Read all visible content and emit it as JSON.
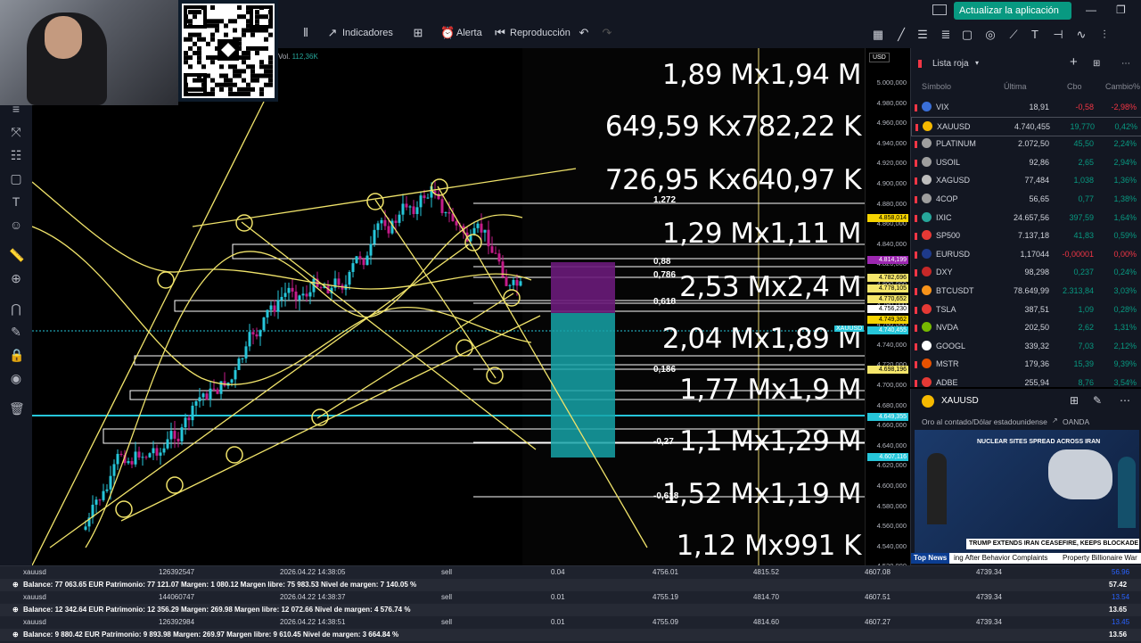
{
  "window": {
    "update_button": "Actualizar la aplicación",
    "minimize": "—",
    "maximize": "❐"
  },
  "toolbar": {
    "indicators": "Indicadores",
    "alert": "Alerta",
    "replay": "Reproducción"
  },
  "chart": {
    "volume_label": "Vol.",
    "volume_value": "112,36K",
    "currency": "USD",
    "symbol_tag": "XAUUSD",
    "price_labels": [
      "5.000,000",
      "4.980,000",
      "4.960,000",
      "4.940,000",
      "4.920,000",
      "4.900,000",
      "4.880,000",
      "4.860,000",
      "4.840,000",
      "4.820,000",
      "4.800,000",
      "4.780,000",
      "4.760,000",
      "4.740,000",
      "4.720,000",
      "4.700,000",
      "4.680,000",
      "4.660,000",
      "4.640,000",
      "4.620,000",
      "4.600,000",
      "4.580,000",
      "4.560,000",
      "4.540,000",
      "4.520,000",
      "4.500,000"
    ],
    "price_tags": [
      {
        "text": "4.858,014",
        "color": "#f5d300"
      },
      {
        "text": "4.814,199",
        "color": "#9c27b0"
      },
      {
        "text": "4.782,696",
        "color": "#f5e66b"
      },
      {
        "text": "4.778,105",
        "color": "#f5e66b"
      },
      {
        "text": "4.770,652",
        "color": "#f5e66b"
      },
      {
        "text": "4.756,230",
        "color": "#ffffff"
      },
      {
        "text": "4.749,362",
        "color": "#f5d300"
      },
      {
        "text": "4.740,455",
        "color": "#26c6da"
      },
      {
        "text": "4.698,196",
        "color": "#f5e66b"
      },
      {
        "text": "4.649,355",
        "color": "#26c6da"
      },
      {
        "text": "4.607,116",
        "color": "#26c6da"
      }
    ],
    "overlay_texts": [
      "1,89 Mx1,94 M",
      "649,59 Kx782,22 K",
      "726,95 Kx640,97 K",
      "1,29 Mx1,11 M",
      "2,53 Mx2,4 M",
      "2,04 Mx1,89 M",
      "1,77 Mx1,9 M",
      "1,1 Mx1,29 M",
      "1,52 Mx1,19 M",
      "1,12 Mx991 K"
    ],
    "fib_levels": [
      "1,272",
      "0,88",
      "0,786",
      "0,618",
      "0,186",
      "-0,27",
      "-0,618"
    ]
  },
  "watchlist": {
    "title": "Lista roja",
    "columns": {
      "symbol": "Símbolo",
      "last": "Última",
      "chg": "Cbo",
      "pct": "Cambio%"
    },
    "rows": [
      {
        "sym": "VIX",
        "last": "18,91",
        "chg": "-0,58",
        "pct": "-2,98%",
        "dir": "neg",
        "logo": "#3a6fd8"
      },
      {
        "sym": "XAUUSD",
        "last": "4.740,455",
        "chg": "19,770",
        "pct": "0,42%",
        "dir": "pos",
        "logo": "#f5b900"
      },
      {
        "sym": "PLATINUM",
        "last": "2.072,50",
        "chg": "45,50",
        "pct": "2,24%",
        "dir": "pos",
        "logo": "#9e9e9e"
      },
      {
        "sym": "USOIL",
        "last": "92,86",
        "chg": "2,65",
        "pct": "2,94%",
        "dir": "pos",
        "logo": "#9e9e9e"
      },
      {
        "sym": "XAGUSD",
        "last": "77,484",
        "chg": "1,038",
        "pct": "1,36%",
        "dir": "pos",
        "logo": "#bdbdbd"
      },
      {
        "sym": "4COP",
        "last": "56,65",
        "chg": "0,77",
        "pct": "1,38%",
        "dir": "pos",
        "logo": "#9e9e9e"
      },
      {
        "sym": "IXIC",
        "last": "24.657,56",
        "chg": "397,59",
        "pct": "1,64%",
        "dir": "pos",
        "logo": "#26a69a"
      },
      {
        "sym": "SP500",
        "last": "7.137,18",
        "chg": "41,83",
        "pct": "0,59%",
        "dir": "pos",
        "logo": "#e53935"
      },
      {
        "sym": "EURUSD",
        "last": "1,17044",
        "chg": "-0,00001",
        "pct": "0,00%",
        "dir": "neg",
        "logo": "#1e3a8a"
      },
      {
        "sym": "DXY",
        "last": "98,298",
        "chg": "0,237",
        "pct": "0,24%",
        "dir": "pos",
        "logo": "#c62828"
      },
      {
        "sym": "BTCUSDT",
        "last": "78.649,99",
        "chg": "2.313,84",
        "pct": "3,03%",
        "dir": "pos",
        "logo": "#f7931a"
      },
      {
        "sym": "TSLA",
        "last": "387,51",
        "chg": "1,09",
        "pct": "0,28%",
        "dir": "pos",
        "logo": "#e53935"
      },
      {
        "sym": "NVDA",
        "last": "202,50",
        "chg": "2,62",
        "pct": "1,31%",
        "dir": "pos",
        "logo": "#76b900"
      },
      {
        "sym": "GOOGL",
        "last": "339,32",
        "chg": "7,03",
        "pct": "2,12%",
        "dir": "pos",
        "logo": "#ffffff"
      },
      {
        "sym": "MSTR",
        "last": "179,36",
        "chg": "15,39",
        "pct": "9,39%",
        "dir": "pos",
        "logo": "#e65100"
      },
      {
        "sym": "ADBE",
        "last": "255,94",
        "chg": "8,76",
        "pct": "3,54%",
        "dir": "pos",
        "logo": "#e53935"
      }
    ]
  },
  "detail": {
    "symbol": "XAUUSD",
    "description": "Oro al contado/Dólar estadounidense",
    "source": "OANDA",
    "news_headline": "NUCLEAR SITES SPREAD ACROSS IRAN",
    "news_lower": "TRUMP EXTENDS IRAN CEASEFIRE, KEEPS BLOCKADE",
    "ticker_label": "Top News",
    "ticker_text": "ing After Behavior Complaints",
    "ticker_text2": "Property Billionaire War"
  },
  "positions": [
    {
      "symbol": "xauusd",
      "ticket": "126392547",
      "time": "2026.04.22 14:38:05",
      "type": "sell",
      "volume": "0.04",
      "open": "4756.01",
      "sl": "4815.52",
      "tp": "4607.08",
      "price": "4739.34",
      "profit": "56.96",
      "profit2": "57.42",
      "balance": "Balance: 77 063.65 EUR  Patrimonio: 77 121.07  Margen: 1 080.12  Margen libre: 75 983.53  Nivel de margen: 7 140.05 %"
    },
    {
      "symbol": "xauusd",
      "ticket": "144060747",
      "time": "2026.04.22 14:38:37",
      "type": "sell",
      "volume": "0.01",
      "open": "4755.19",
      "sl": "4814.70",
      "tp": "4607.51",
      "price": "4739.34",
      "profit": "13.54",
      "profit2": "13.65",
      "balance": "Balance: 12 342.64 EUR  Patrimonio: 12 356.29  Margen: 269.98  Margen libre: 12 072.66  Nivel de margen: 4 576.74 %"
    },
    {
      "symbol": "xauusd",
      "ticket": "126392984",
      "time": "2026.04.22 14:38:51",
      "type": "sell",
      "volume": "0.01",
      "open": "4755.09",
      "sl": "4814.60",
      "tp": "4607.27",
      "price": "4739.34",
      "profit": "13.45",
      "profit2": "13.56",
      "balance": "Balance: 9 880.42 EUR  Patrimonio: 9 893.98  Margen: 269.97  Margen libre: 9 610.45  Nivel de margen: 3 664.84 %"
    }
  ]
}
